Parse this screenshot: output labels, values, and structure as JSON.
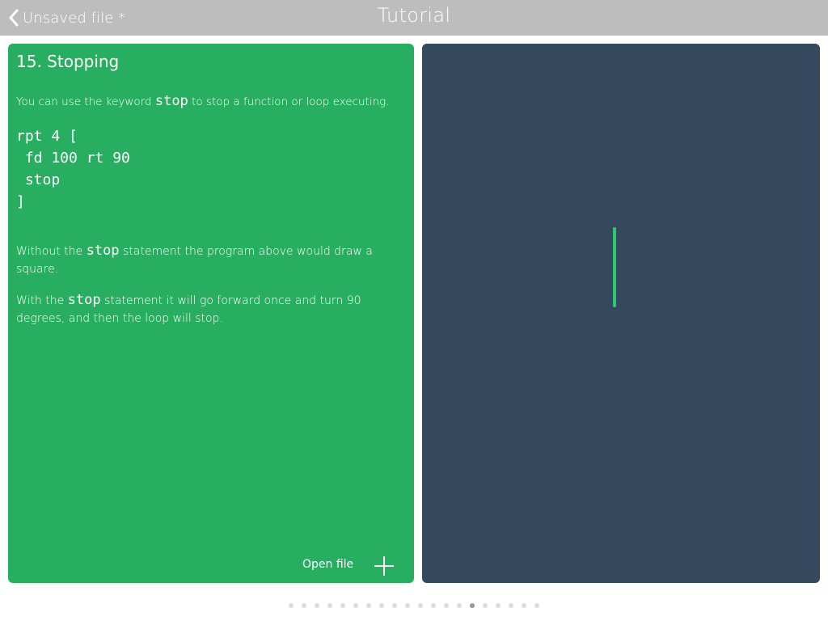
{
  "header": {
    "back_label": "Unsaved file *",
    "title": "Tutorial"
  },
  "tutorial": {
    "heading": "15. Stopping",
    "intro_before": "You can use the keyword ",
    "intro_keyword": "stop",
    "intro_after": " to stop a function or loop executing.",
    "code_lines": [
      "rpt 4 [",
      " fd 100 rt 90",
      " stop",
      "]"
    ],
    "para2_before": "Without the ",
    "para2_keyword": "stop",
    "para2_after": " statement the program above would draw a square.",
    "para3_before": "With the ",
    "para3_keyword": "stop",
    "para3_after": " statement it will go forward once and turn 90 degrees, and then the loop will stop.",
    "open_file_label": "Open file",
    "plus_icon": "plus-icon"
  },
  "canvas": {
    "background": "#34495e",
    "line_color": "#2ecc71"
  },
  "pager": {
    "total_pages": 20,
    "current_page": 15
  },
  "colors": {
    "topbar": "#bdbdbd",
    "tutorial_panel": "#27ae60",
    "canvas_panel": "#34495e"
  }
}
